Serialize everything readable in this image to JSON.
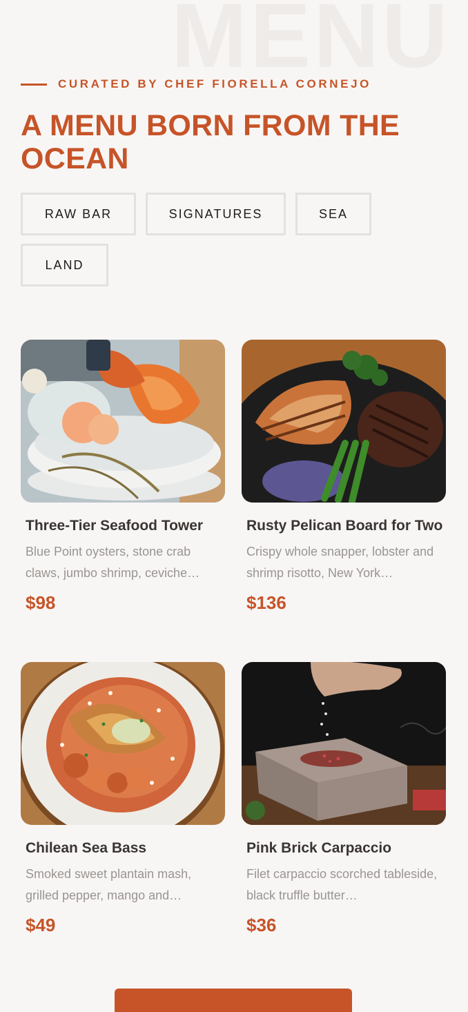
{
  "background_word": "MENU",
  "eyebrow": {
    "text": "CURATED BY CHEF FIORELLA CORNEJO"
  },
  "title": "A MENU BORN FROM THE OCEAN",
  "tabs": [
    "RAW BAR",
    "SIGNATURES",
    "SEA",
    "LAND"
  ],
  "items": [
    {
      "name": "Three-Tier Seafood Tower",
      "description": "Blue Point oysters, stone crab claws, jumbo shrimp, ceviche…",
      "price": "$98",
      "image": "seafood-tower-photo"
    },
    {
      "name": "Rusty Pelican Board for Two",
      "description": "Crispy whole snapper, lobster and shrimp risotto, New York…",
      "price": "$136",
      "image": "surf-and-turf-board-photo"
    },
    {
      "name": "Chilean Sea Bass",
      "description": "Smoked sweet plantain mash, grilled pepper, mango and…",
      "price": "$49",
      "image": "sea-bass-risotto-photo"
    },
    {
      "name": "Pink Brick Carpaccio",
      "description": "Filet carpaccio scorched tableside, black truffle butter…",
      "price": "$36",
      "image": "salt-brick-carpaccio-photo"
    }
  ],
  "colors": {
    "accent": "#c65428",
    "background": "#f8f6f5",
    "tab_border": "#e3e0de"
  }
}
